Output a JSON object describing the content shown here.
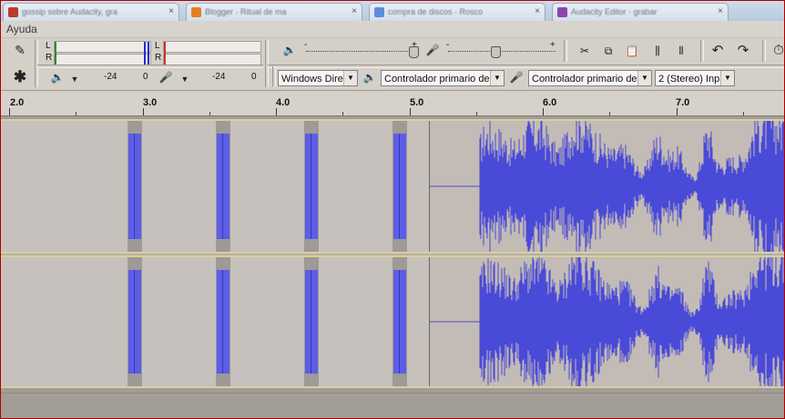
{
  "browser_tabs": [
    {
      "title": "gossip sobre Audacity, gra",
      "favicon_color": "#c0392b",
      "has_close": true
    },
    {
      "title": "Blogger · Ritual de ma",
      "favicon_color": "#e67e22",
      "has_close": true
    },
    {
      "title": "compra de discos · Rosco",
      "favicon_color": "#5b8fd8",
      "has_close": true
    },
    {
      "title": "Audacity Editor · grabar",
      "favicon_color": "#8e44ad",
      "has_close": true
    }
  ],
  "menubar": {
    "help": "Ayuda"
  },
  "meter": {
    "record_l": "L",
    "record_r": "R",
    "play_l": "L",
    "play_r": "R",
    "scale_left_minus24": "-24",
    "scale_left_zero": "0",
    "scale_right_minus24": "-24",
    "scale_right_zero": "0"
  },
  "mixer": {
    "minus": "-",
    "plus": "+"
  },
  "device": {
    "host": "Windows Dire",
    "playback": "Controlador primario de",
    "recording": "Controlador primario de",
    "channels": "2 (Stereo) Inp"
  },
  "ruler": {
    "labels": [
      "2.0",
      "3.0",
      "4.0",
      "5.0",
      "6.0",
      "7.0"
    ]
  },
  "icons": {
    "pencil": "✎",
    "multi": "✱",
    "speaker": "🔈",
    "mic": "🎤",
    "cut": "✂",
    "copy": "⧉",
    "paste": "📋",
    "trim": "⫼",
    "silence": "⫴",
    "undo": "↶",
    "redo": "↷",
    "zoom": "⏱"
  },
  "colors": {
    "waveform": "#4a4ad8",
    "clip_fill": "#5d5de6",
    "track_border": "#d8cfa0"
  }
}
